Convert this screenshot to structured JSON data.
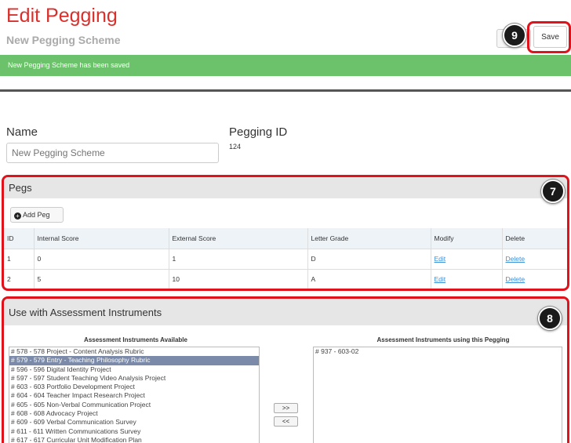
{
  "header": {
    "title": "Edit Pegging",
    "subtitle": "New Pegging Scheme",
    "save_label": "Save",
    "callout_save": "9"
  },
  "alert": {
    "message": "New Pegging Scheme has been saved",
    "color": "#6cc26a"
  },
  "form": {
    "name_label": "Name",
    "name_placeholder": "New Pegging Scheme",
    "pegging_id_label": "Pegging ID",
    "pegging_id_value": "124"
  },
  "pegs": {
    "title": "Pegs",
    "callout": "7",
    "add_label": "Add Peg",
    "columns": [
      "ID",
      "Internal Score",
      "External Score",
      "Letter Grade",
      "Modify",
      "Delete"
    ],
    "rows": [
      {
        "id": "1",
        "internal": "0",
        "external": "1",
        "grade": "D",
        "modify": "Edit",
        "delete": "Delete"
      },
      {
        "id": "2",
        "internal": "5",
        "external": "10",
        "grade": "A",
        "modify": "Edit",
        "delete": "Delete"
      }
    ]
  },
  "instruments": {
    "title": "Use with Assessment Instruments",
    "callout": "8",
    "available_label": "Assessment Instruments Available",
    "using_label": "Assessment Instruments using this Pegging",
    "available": [
      "# 578 - 578 Project - Content Analysis Rubric",
      "# 579 - 579 Entry - Teaching Philosophy Rubric",
      "# 596 - 596 Digital Identity Project",
      "# 597 - 597 Student Teaching Video Analysis Project",
      "# 603 - 603 Portfolio Development Project",
      "# 604 - 604 Teacher Impact Research Project",
      "# 605 - 605 Non-Verbal Communication Project",
      "# 608 - 608 Advocacy Project",
      "# 609 - 609 Verbal Communication Survey",
      "# 611 - 611 Written Communications Survey",
      "# 617 - 617 Curricular Unit Modification Plan"
    ],
    "selected_index": 1,
    "using": [
      "# 937 - 603-02"
    ],
    "add_btn": ">>",
    "remove_btn": "<<"
  },
  "colors": {
    "accent_red": "#d9302c",
    "annotation_red": "#e0121b",
    "link_blue": "#3a8fd9"
  }
}
